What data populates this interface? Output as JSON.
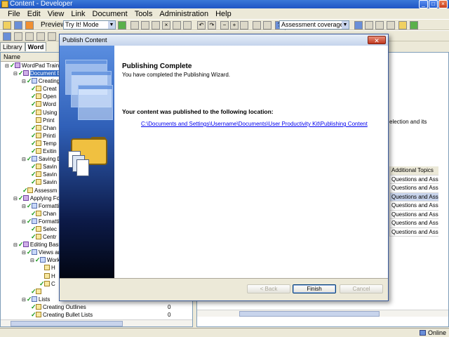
{
  "window": {
    "title": "Content - Developer"
  },
  "menu": {
    "items": [
      "File",
      "Edit",
      "View",
      "Link",
      "Document",
      "Tools",
      "Administration",
      "Help"
    ]
  },
  "toolbar": {
    "preview_label": "Preview:",
    "preview_mode": "Try It! Mode",
    "view_select": "Assessment coverage view"
  },
  "left_pane": {
    "tabs": [
      "Library",
      "Word"
    ],
    "column_header": "Name",
    "tree": [
      {
        "label": "WordPad Training",
        "indent": 0,
        "icon": "book",
        "check": true
      },
      {
        "label": "Document Ba",
        "indent": 1,
        "icon": "book",
        "check": true,
        "selected": true
      },
      {
        "label": "Creating",
        "indent": 2,
        "icon": "module",
        "check": true
      },
      {
        "label": "Creat",
        "indent": 3,
        "icon": "topic",
        "check": true
      },
      {
        "label": "Open",
        "indent": 3,
        "icon": "topic",
        "check": true
      },
      {
        "label": "Word",
        "indent": 3,
        "icon": "topic",
        "check": true
      },
      {
        "label": "Using",
        "indent": 3,
        "icon": "topic",
        "check": true
      },
      {
        "label": "Print",
        "indent": 3,
        "icon": "topic",
        "check": false
      },
      {
        "label": "Chan",
        "indent": 3,
        "icon": "topic",
        "check": true
      },
      {
        "label": "Printi",
        "indent": 3,
        "icon": "topic",
        "check": true
      },
      {
        "label": "Temp",
        "indent": 3,
        "icon": "topic",
        "check": true
      },
      {
        "label": "Exitin",
        "indent": 3,
        "icon": "topic",
        "check": true
      },
      {
        "label": "Saving D",
        "indent": 2,
        "icon": "module",
        "check": true
      },
      {
        "label": "Savin",
        "indent": 3,
        "icon": "topic",
        "check": true
      },
      {
        "label": "Savin",
        "indent": 3,
        "icon": "topic",
        "check": true
      },
      {
        "label": "Savin",
        "indent": 3,
        "icon": "topic",
        "check": true
      },
      {
        "label": "Assessm",
        "indent": 2,
        "icon": "topic",
        "check": true
      },
      {
        "label": "Applying For",
        "indent": 1,
        "icon": "book",
        "check": true
      },
      {
        "label": "Formattin",
        "indent": 2,
        "icon": "module",
        "check": true
      },
      {
        "label": "Chan",
        "indent": 3,
        "icon": "topic",
        "check": true
      },
      {
        "label": "Formatti",
        "indent": 2,
        "icon": "module",
        "check": true
      },
      {
        "label": "Selec",
        "indent": 3,
        "icon": "topic",
        "check": true
      },
      {
        "label": "Centr",
        "indent": 3,
        "icon": "topic",
        "check": true
      },
      {
        "label": "Editing Basi",
        "indent": 1,
        "icon": "book",
        "check": true
      },
      {
        "label": "Views and",
        "indent": 2,
        "icon": "module",
        "check": true
      },
      {
        "label": "Work",
        "indent": 3,
        "icon": "module",
        "check": true
      },
      {
        "label": "H",
        "indent": 4,
        "icon": "topic",
        "check": false
      },
      {
        "label": "H",
        "indent": 4,
        "icon": "topic",
        "check": false
      },
      {
        "label": "C",
        "indent": 4,
        "icon": "topic",
        "check": true
      },
      {
        "label": "",
        "indent": 3,
        "icon": "topic",
        "check": true
      },
      {
        "label": "Lists",
        "indent": 2,
        "icon": "module",
        "check": true
      },
      {
        "label": "Creating Outlines",
        "indent": 3,
        "icon": "topic",
        "check": true,
        "count": "0"
      },
      {
        "label": "Creating Bullet Lists",
        "indent": 3,
        "icon": "topic",
        "check": true,
        "count": "0"
      }
    ]
  },
  "right_pane": {
    "text_line1": "election and its",
    "text_line2": "",
    "column_header": "Additional Topics",
    "rows": [
      "Questions and Ass...",
      "Questions and Ass...",
      "Questions and Ass...",
      "Questions and Ass...",
      "Questions and Ass...",
      "Questions and Ass...",
      "Questions and Ass..."
    ]
  },
  "status": {
    "online": "Online"
  },
  "dialog": {
    "title": "Publish Content",
    "heading": "Publishing Complete",
    "subheading": "You have completed the Publishing Wizard.",
    "location_label": "Your content was published to the following location:",
    "location_link": "C:\\Documents and Settings\\Username\\Documents\\User Productivity Kit\\Publishing Content",
    "back_label": "< Back",
    "finish_label": "Finish",
    "cancel_label": "Cancel"
  }
}
